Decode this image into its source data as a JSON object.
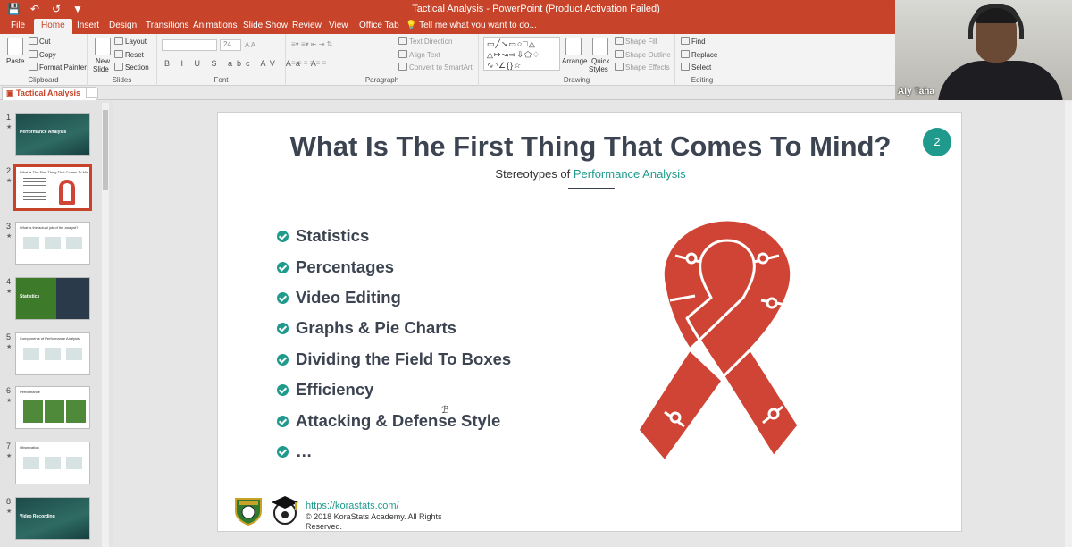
{
  "window": {
    "title": "Tactical Analysis - PowerPoint (Product Activation Failed)",
    "qat_icons": [
      "save-icon",
      "undo-icon",
      "redo-icon",
      "customize-icon"
    ]
  },
  "tabs": [
    "File",
    "Home",
    "Insert",
    "Design",
    "Transitions",
    "Animations",
    "Slide Show",
    "Review",
    "View",
    "Office Tab"
  ],
  "active_tab": "Home",
  "tell_me": "Tell me what you want to do...",
  "ribbon": {
    "clipboard": {
      "label": "Clipboard",
      "paste": "Paste",
      "cut": "Cut",
      "copy": "Copy",
      "format_painter": "Format Painter"
    },
    "slides": {
      "label": "Slides",
      "new_slide_line1": "New",
      "new_slide_line2": "Slide",
      "layout": "Layout",
      "reset": "Reset",
      "section": "Section"
    },
    "font": {
      "label": "Font",
      "name": "",
      "size": "24",
      "format_buttons": "B I U S abc AV Aa A"
    },
    "paragraph": {
      "label": "Paragraph",
      "text_direction": "Text Direction",
      "align_text": "Align Text",
      "convert_smartart": "Convert to SmartArt"
    },
    "drawing": {
      "label": "Drawing",
      "arrange": "Arrange",
      "quick_styles_line1": "Quick",
      "quick_styles_line2": "Styles",
      "shape_fill": "Shape Fill",
      "shape_outline": "Shape Outline",
      "shape_effects": "Shape Effects"
    },
    "editing": {
      "label": "Editing",
      "find": "Find",
      "replace": "Replace",
      "select": "Select"
    }
  },
  "document_tab": "Tactical Analysis",
  "webcam": {
    "name": "Aly Taha"
  },
  "thumbnails": [
    {
      "num": "1",
      "text": "Performance Analysis",
      "theme": "dark-stadium"
    },
    {
      "num": "2",
      "text": "What Is The First Thing That Comes To Mind?",
      "theme": "light-ribbon"
    },
    {
      "num": "3",
      "text": "What is the actual job of the analyst?",
      "theme": "light"
    },
    {
      "num": "4",
      "text": "Statistics",
      "theme": "pitch-dark"
    },
    {
      "num": "5",
      "text": "Components of Performance Analysis",
      "theme": "light"
    },
    {
      "num": "6",
      "text": "Performance",
      "theme": "light-pitch"
    },
    {
      "num": "7",
      "text": "Observation",
      "theme": "light"
    },
    {
      "num": "8",
      "text": "Video Recording",
      "theme": "dark-stadium"
    }
  ],
  "selected_slide": "2",
  "slide": {
    "title": "What Is The First Thing That Comes To Mind?",
    "subtitle_prefix": "Stereotypes of",
    "subtitle_accent": "Performance Analysis",
    "number": "2",
    "bullets": [
      "Statistics",
      "Percentages",
      "Video Editing",
      "Graphs & Pie Charts",
      "Dividing the Field To Boxes",
      "Efficiency",
      "Attacking & Defense Style",
      "…"
    ],
    "footer_link": "https://korastats.com/",
    "footer_copyright": "© 2018 KoraStats Academy. All Rights Reserved.",
    "accent_color": "#1f9a8c",
    "ribbon_color": "#cf4434"
  },
  "colors": {
    "brand": "#c7442a",
    "teal": "#1f9a8c",
    "title_text": "#3d4451"
  }
}
